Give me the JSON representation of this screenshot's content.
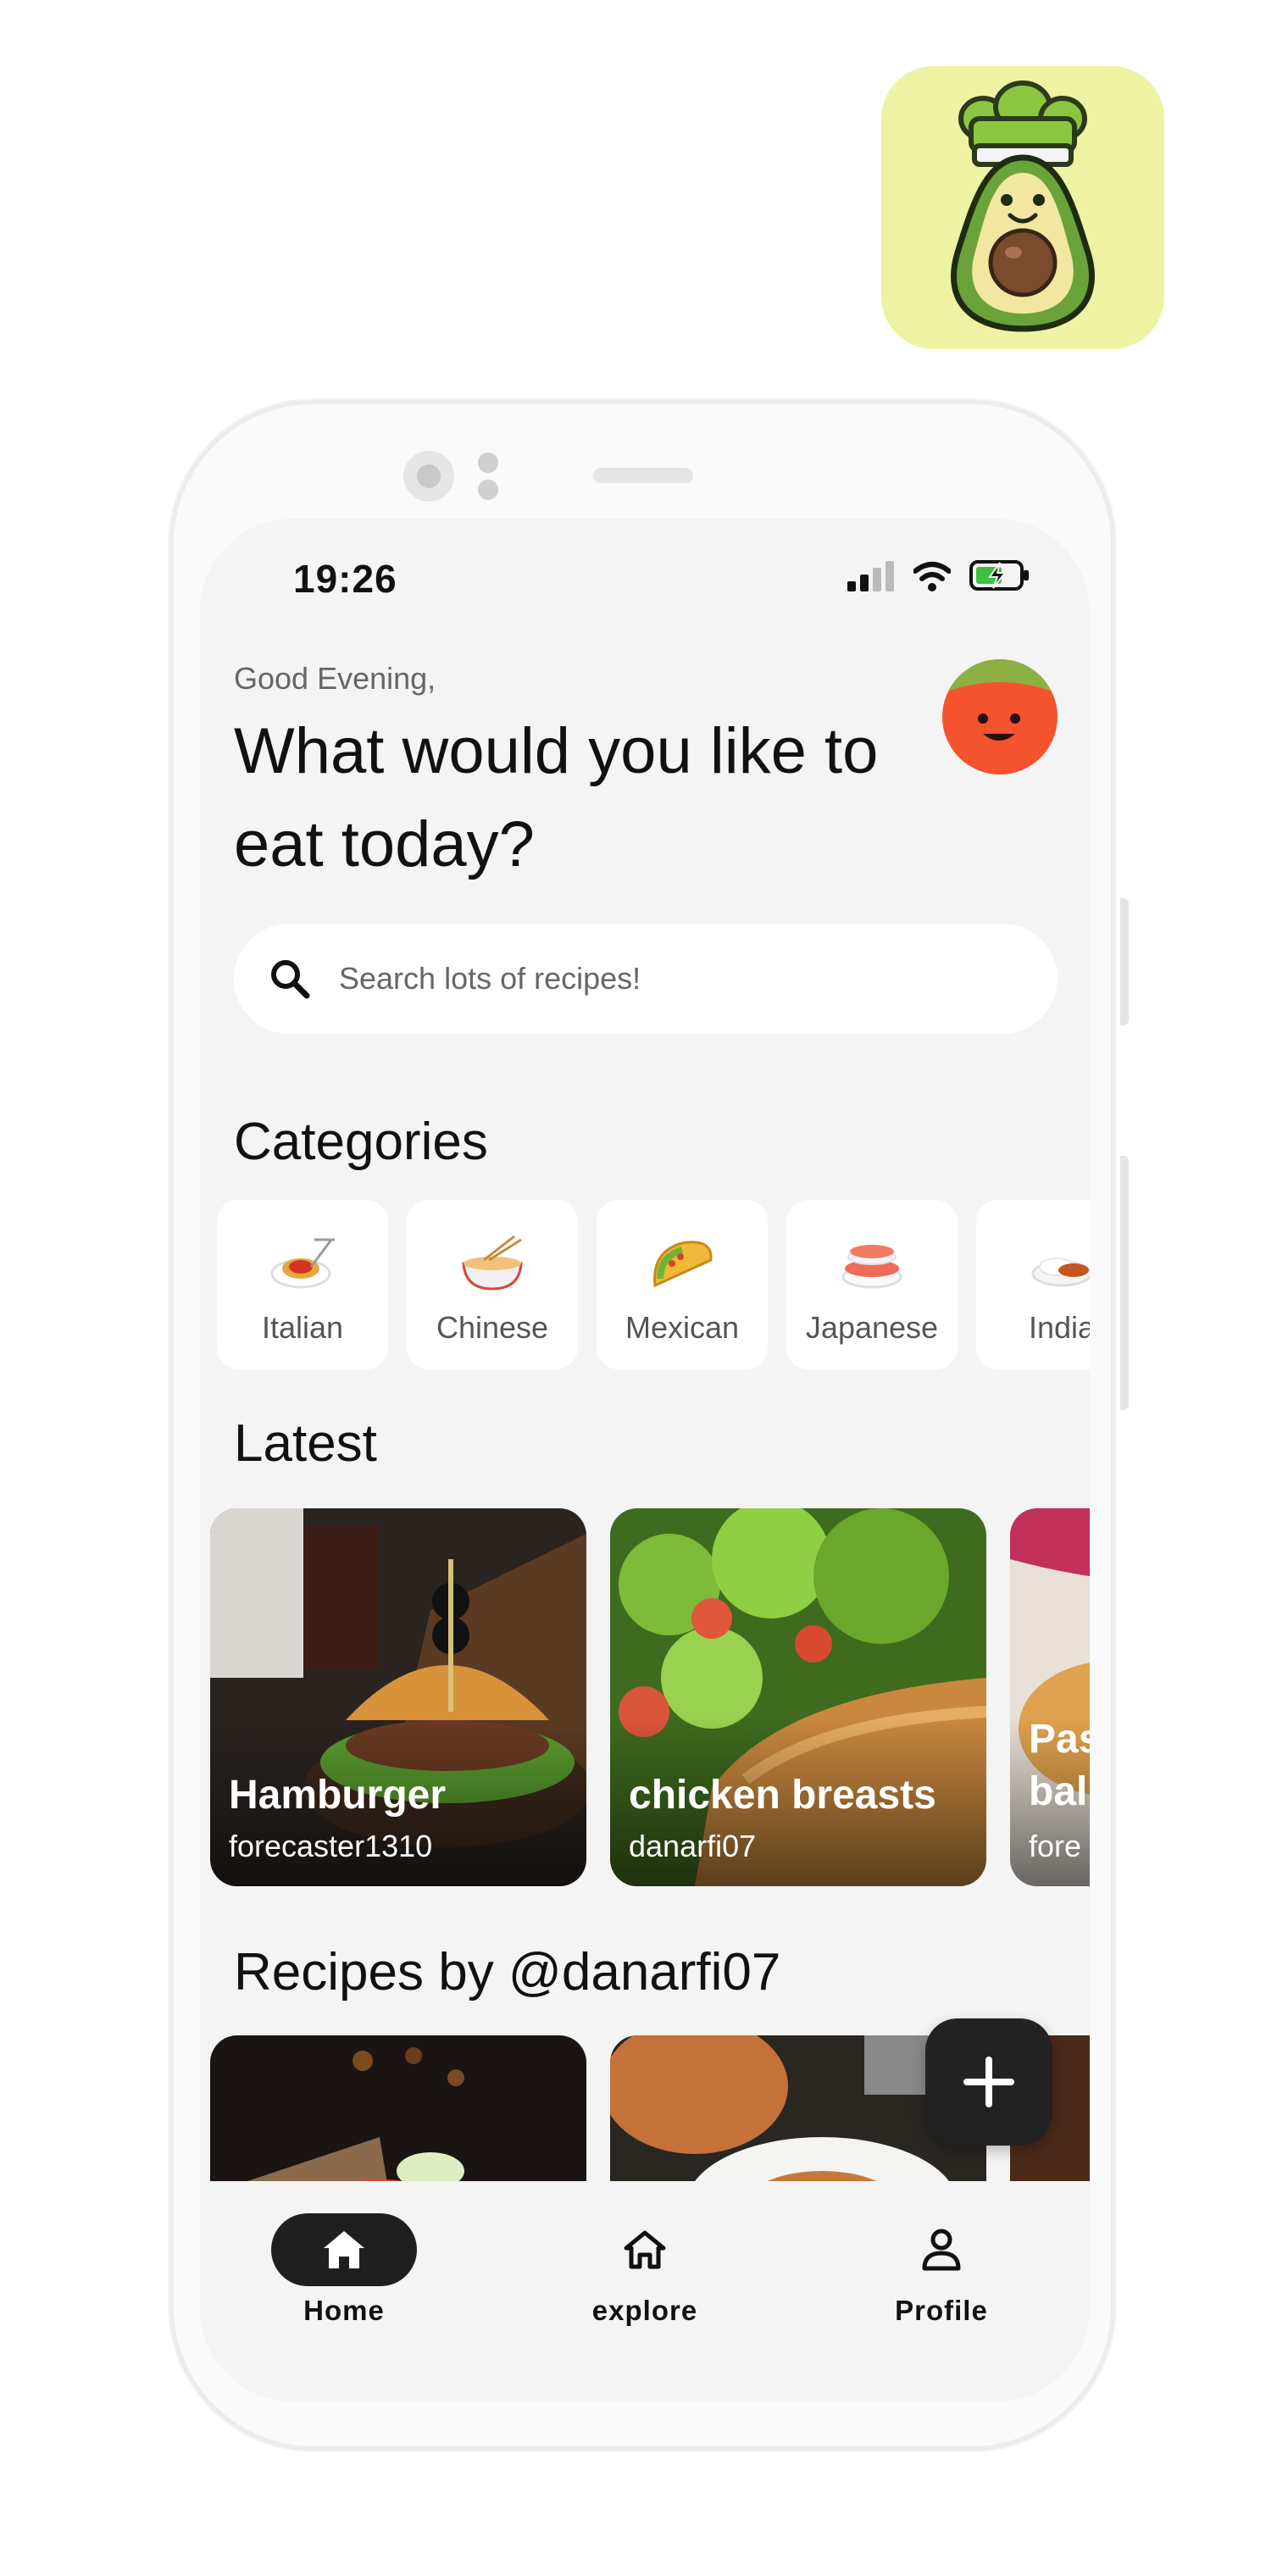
{
  "status_bar": {
    "time": "19:26"
  },
  "header": {
    "greeting": "Good Evening,",
    "headline": "What would you like to eat today?"
  },
  "search": {
    "placeholder": "Search lots of recipes!"
  },
  "categories": {
    "title": "Categories",
    "items": [
      {
        "label": "Italian",
        "icon": "spaghetti-icon"
      },
      {
        "label": "Chinese",
        "icon": "noodle-bowl-icon"
      },
      {
        "label": "Mexican",
        "icon": "taco-icon"
      },
      {
        "label": "Japanese",
        "icon": "sushi-icon"
      },
      {
        "label": "India",
        "icon": "curry-rice-icon"
      }
    ]
  },
  "latest": {
    "title": "Latest",
    "items": [
      {
        "title": "Hamburger",
        "author": "forecaster1310"
      },
      {
        "title": "chicken breasts",
        "author": "danarfi07"
      },
      {
        "title": "Pas bal",
        "author": "fore"
      }
    ]
  },
  "recipes_by": {
    "title": "Recipes by @danarfi07"
  },
  "fab": {
    "icon": "plus-icon"
  },
  "bottom_nav": {
    "items": [
      {
        "label": "Home",
        "icon": "home-icon",
        "active": true
      },
      {
        "label": "explore",
        "icon": "home-outline-icon",
        "active": false
      },
      {
        "label": "Profile",
        "icon": "person-icon",
        "active": false
      }
    ]
  },
  "colors": {
    "background": "#f4f4f4",
    "app_icon_bg": "#eef3a4",
    "dark": "#222222",
    "avatar_face": "#f4532e",
    "avatar_top": "#8db043"
  }
}
